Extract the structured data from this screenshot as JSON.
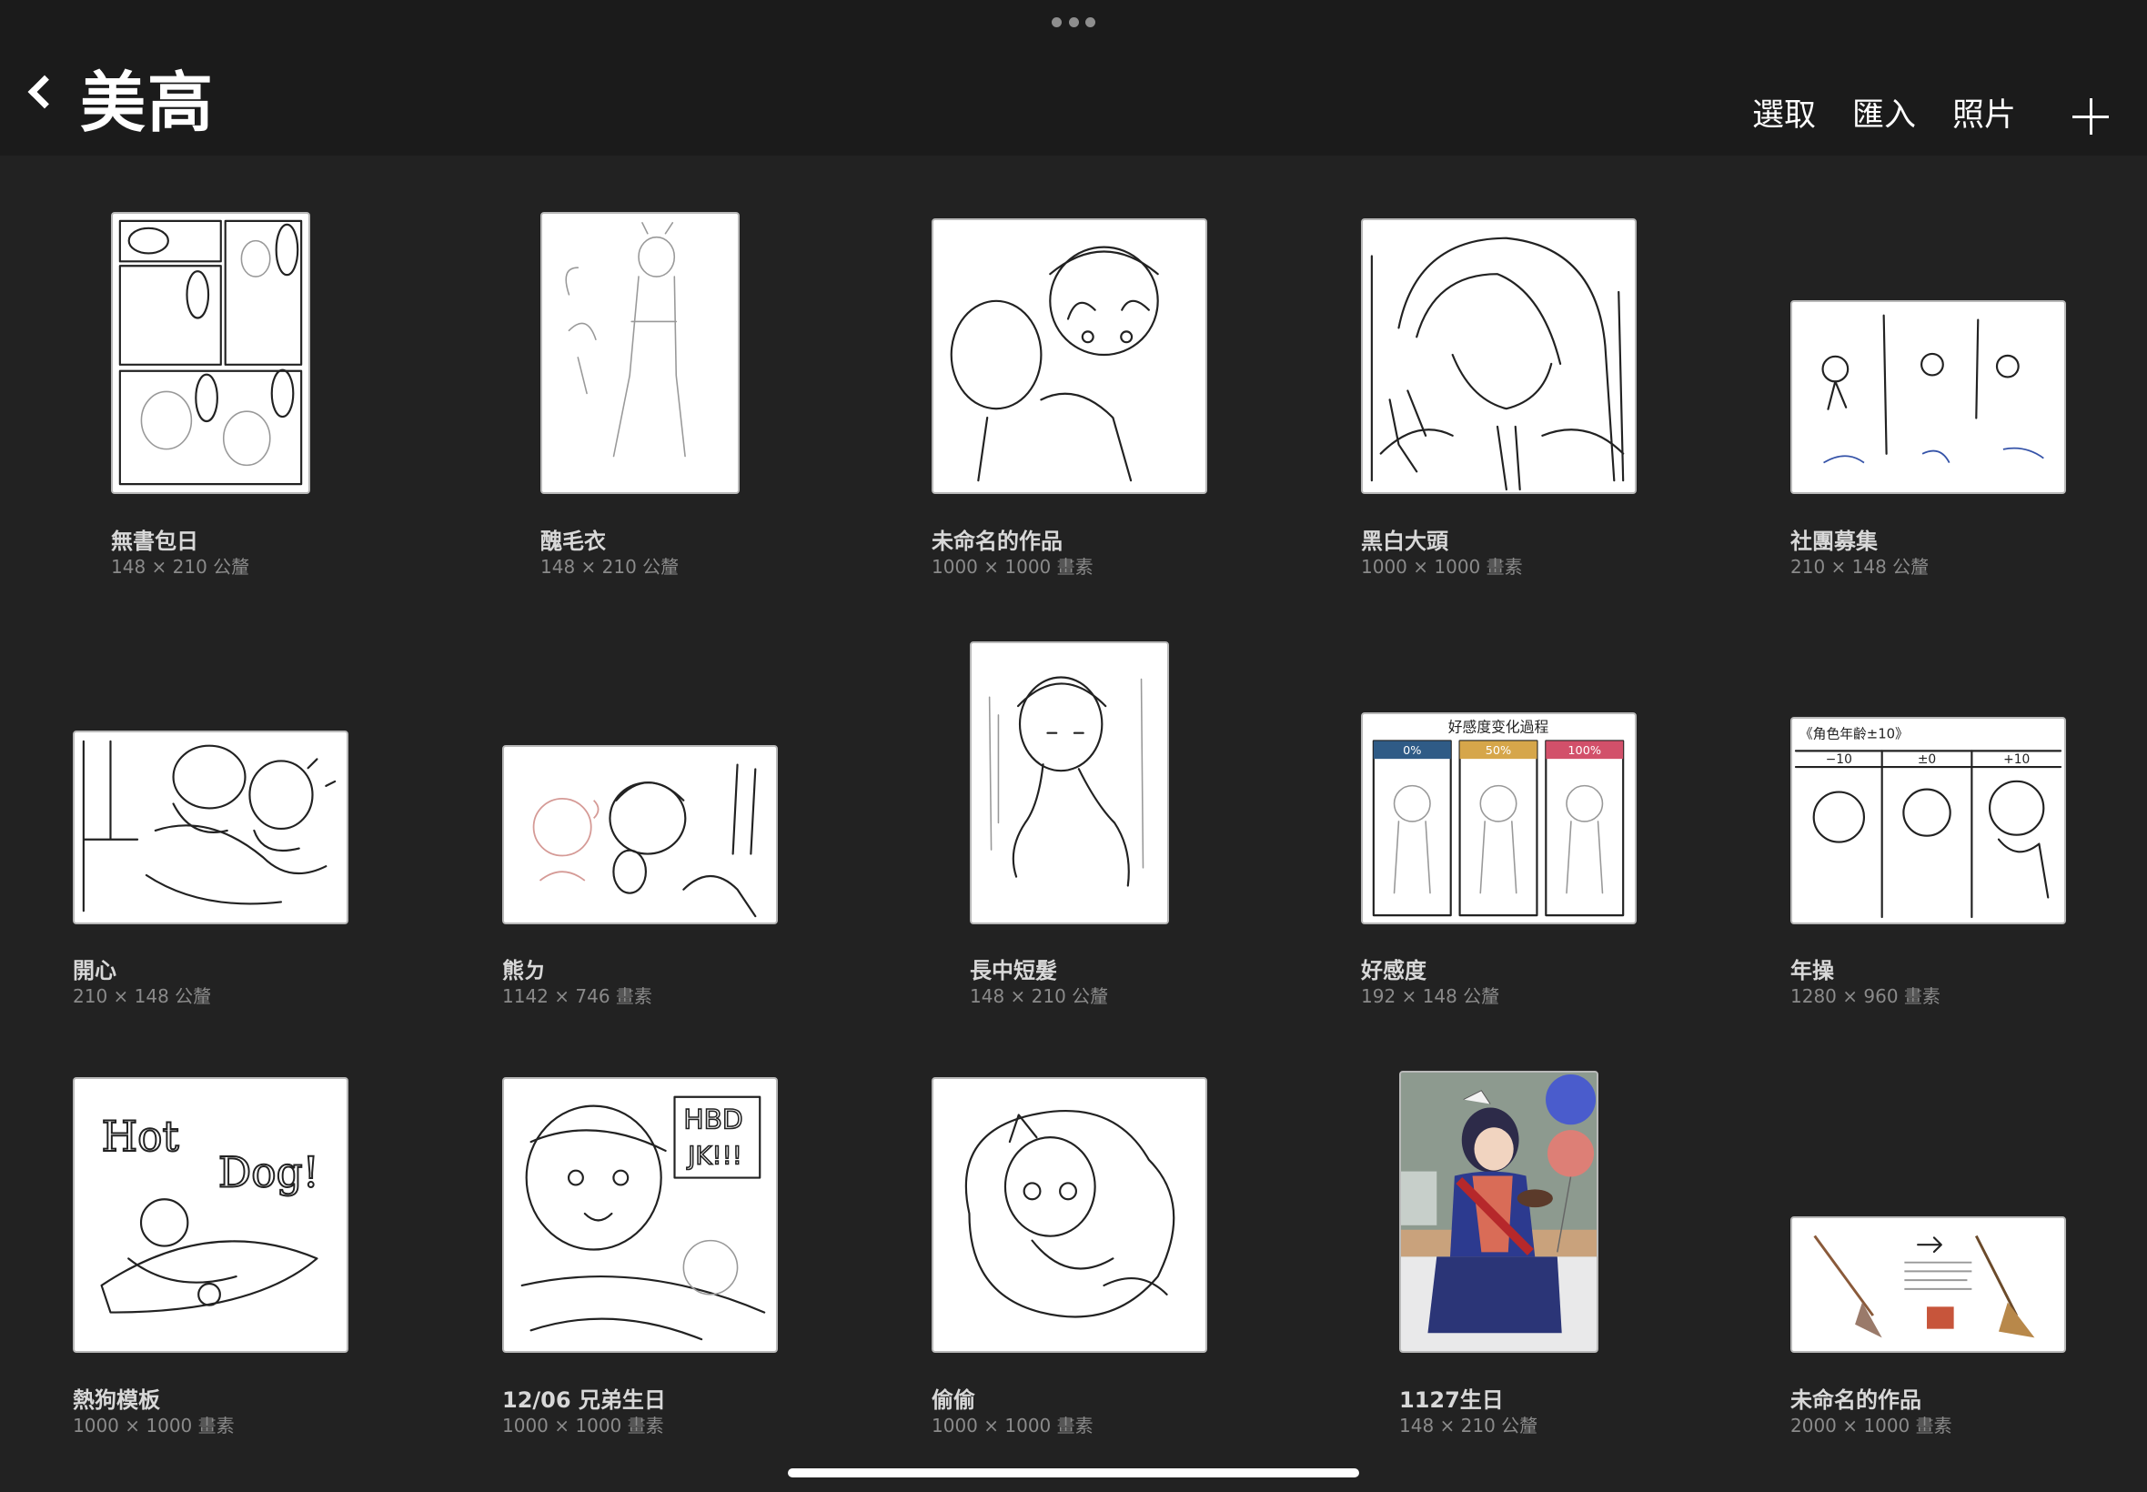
{
  "header": {
    "title": "美高",
    "select_label": "選取",
    "import_label": "匯入",
    "photo_label": "照片"
  },
  "artworks": [
    {
      "title": "無書包日",
      "size": "148 × 210 公釐"
    },
    {
      "title": "醜毛衣",
      "size": "148 × 210 公釐"
    },
    {
      "title": "未命名的作品",
      "size": "1000 × 1000 畫素"
    },
    {
      "title": "黑白大頭",
      "size": "1000 × 1000 畫素"
    },
    {
      "title": "社團募集",
      "size": "210 × 148 公釐"
    },
    {
      "title": "開心",
      "size": "210 × 148 公釐"
    },
    {
      "title": "熊ㄉ",
      "size": "1142 × 746 畫素"
    },
    {
      "title": "長中短髮",
      "size": "148 × 210 公釐"
    },
    {
      "title": "好感度",
      "size": "192 × 148 公釐"
    },
    {
      "title": "年操",
      "size": "1280 × 960 畫素"
    },
    {
      "title": "熱狗模板",
      "size": "1000 × 1000 畫素"
    },
    {
      "title": "12/06 兄弟生日",
      "size": "1000 × 1000 畫素"
    },
    {
      "title": "偷偷",
      "size": "1000 × 1000 畫素"
    },
    {
      "title": "1127生日",
      "size": "148 × 210 公釐"
    },
    {
      "title": "未命名的作品",
      "size": "2000 × 1000 畫素"
    }
  ],
  "thumb_text": {
    "favor_title": "好感度变化過程",
    "favor_0": "0%",
    "favor_50": "50%",
    "favor_100": "100%",
    "age_title": "《角色年齡±10》",
    "age_minus": "−10",
    "age_zero": "±0",
    "age_plus": "+10",
    "hotdog_1": "Hot",
    "hotdog_2": "Dog!",
    "hbd_1": "HBD",
    "hbd_2": "JK!!!"
  },
  "colors": {
    "background": "#222222",
    "header_background": "#1b1b1b",
    "favor_0": "#2f5b86",
    "favor_50": "#d6a64a",
    "favor_100": "#d2506a"
  }
}
